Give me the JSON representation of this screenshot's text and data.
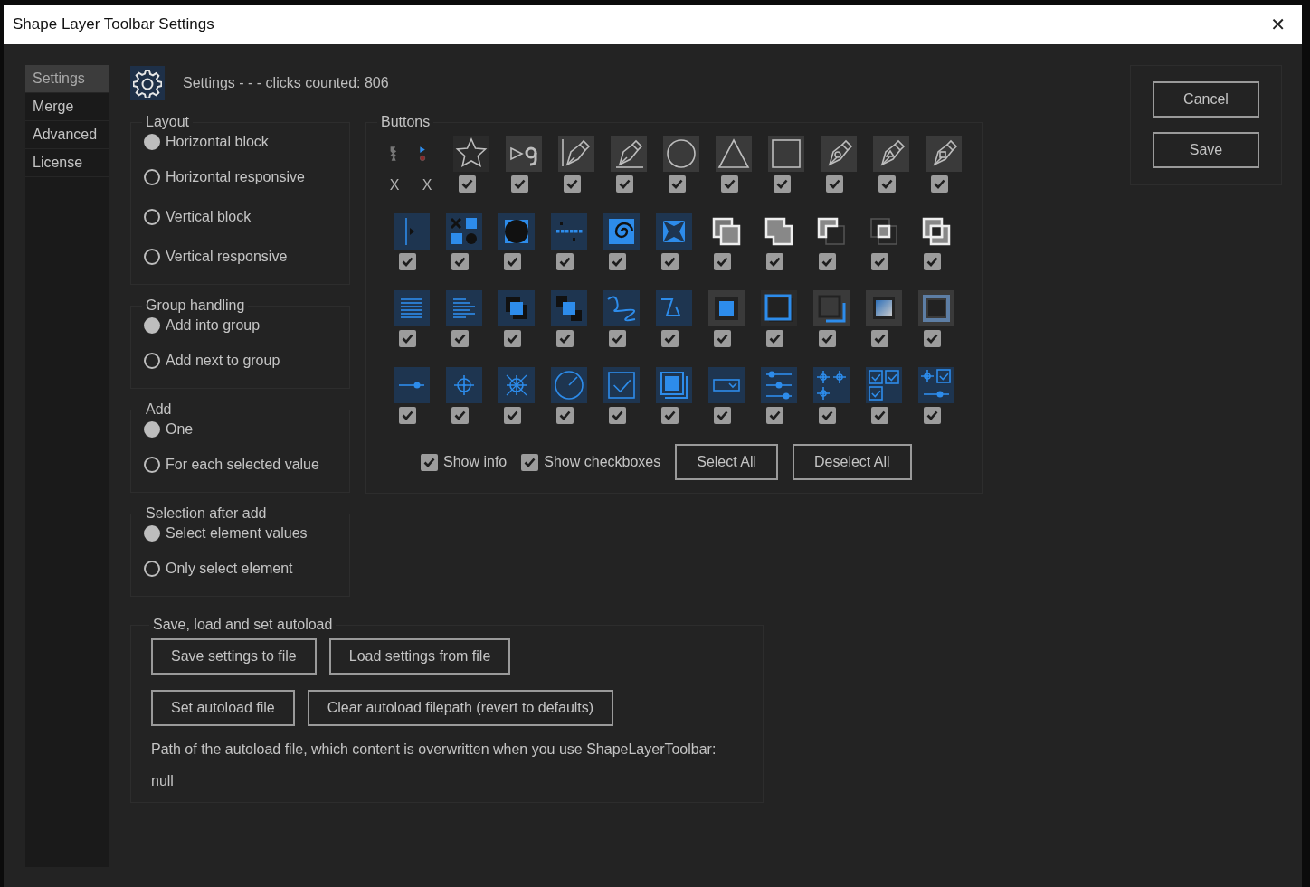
{
  "window": {
    "title": "Shape Layer Toolbar Settings",
    "close": "✕"
  },
  "sidebar": {
    "items": [
      {
        "label": "Settings",
        "selected": true
      },
      {
        "label": "Merge",
        "selected": false
      },
      {
        "label": "Advanced",
        "selected": false
      },
      {
        "label": "License",
        "selected": false
      }
    ]
  },
  "header": {
    "text": "Settings - - - clicks counted: 806"
  },
  "groups": [
    {
      "title": "Layout",
      "options": [
        {
          "label": "Horizontal block",
          "selected": true
        },
        {
          "label": "Horizontal responsive",
          "selected": false
        },
        {
          "label": "Vertical block",
          "selected": false
        },
        {
          "label": "Vertical responsive",
          "selected": false
        }
      ]
    },
    {
      "title": "Group handling",
      "options": [
        {
          "label": "Add into group",
          "selected": true
        },
        {
          "label": "Add next to group",
          "selected": false
        }
      ]
    },
    {
      "title": "Add",
      "options": [
        {
          "label": "One",
          "selected": true
        },
        {
          "label": "For each selected value",
          "selected": false
        }
      ]
    },
    {
      "title": "Selection after add",
      "options": [
        {
          "label": "Select element values",
          "selected": true
        },
        {
          "label": "Only select element",
          "selected": false
        }
      ]
    }
  ],
  "buttons": {
    "title": "Buttons",
    "rows": [
      [
        {
          "kind": "fixed",
          "label": "X"
        },
        {
          "kind": "fixed",
          "label": "X"
        },
        {
          "kind": "toggle",
          "checked": true
        },
        {
          "kind": "toggle",
          "checked": true
        },
        {
          "kind": "toggle",
          "checked": true
        },
        {
          "kind": "toggle",
          "checked": true
        },
        {
          "kind": "toggle",
          "checked": true
        },
        {
          "kind": "toggle",
          "checked": true
        },
        {
          "kind": "toggle",
          "checked": true
        },
        {
          "kind": "toggle",
          "checked": true
        },
        {
          "kind": "toggle",
          "checked": true
        },
        {
          "kind": "toggle",
          "checked": true
        }
      ],
      [
        {
          "kind": "toggle",
          "checked": true
        },
        {
          "kind": "toggle",
          "checked": true
        },
        {
          "kind": "toggle",
          "checked": true
        },
        {
          "kind": "toggle",
          "checked": true
        },
        {
          "kind": "toggle",
          "checked": true
        },
        {
          "kind": "toggle",
          "checked": true
        },
        {
          "kind": "toggle",
          "checked": true
        },
        {
          "kind": "toggle",
          "checked": true
        },
        {
          "kind": "toggle",
          "checked": true
        },
        {
          "kind": "toggle",
          "checked": true
        },
        {
          "kind": "toggle",
          "checked": true
        }
      ],
      [
        {
          "kind": "toggle",
          "checked": true
        },
        {
          "kind": "toggle",
          "checked": true
        },
        {
          "kind": "toggle",
          "checked": true
        },
        {
          "kind": "toggle",
          "checked": true
        },
        {
          "kind": "toggle",
          "checked": true
        },
        {
          "kind": "toggle",
          "checked": true
        },
        {
          "kind": "toggle",
          "checked": true
        },
        {
          "kind": "toggle",
          "checked": true
        },
        {
          "kind": "toggle",
          "checked": true
        },
        {
          "kind": "toggle",
          "checked": true
        },
        {
          "kind": "toggle",
          "checked": true
        }
      ],
      [
        {
          "kind": "toggle",
          "checked": true
        },
        {
          "kind": "toggle",
          "checked": true
        },
        {
          "kind": "toggle",
          "checked": true
        },
        {
          "kind": "toggle",
          "checked": true
        },
        {
          "kind": "toggle",
          "checked": true
        },
        {
          "kind": "toggle",
          "checked": true
        },
        {
          "kind": "toggle",
          "checked": true
        },
        {
          "kind": "toggle",
          "checked": true
        },
        {
          "kind": "toggle",
          "checked": true
        },
        {
          "kind": "toggle",
          "checked": true
        },
        {
          "kind": "toggle",
          "checked": true
        }
      ]
    ],
    "options": [
      {
        "label": "Show info",
        "checked": true
      },
      {
        "label": "Show checkboxes",
        "checked": true
      }
    ],
    "actions": [
      "Select All",
      "Deselect All"
    ]
  },
  "file": {
    "title": "Save, load and set autoload",
    "actions": [
      [
        "Save settings to file",
        "Load settings from file"
      ],
      [
        "Set autoload file",
        "Clear autoload filepath (revert to defaults)"
      ]
    ],
    "path_label": "Path of the autoload file, which content is overwritten when you use ShapeLayerToolbar:",
    "path_value": "null"
  },
  "dialog_buttons": [
    "Cancel",
    "Save"
  ]
}
